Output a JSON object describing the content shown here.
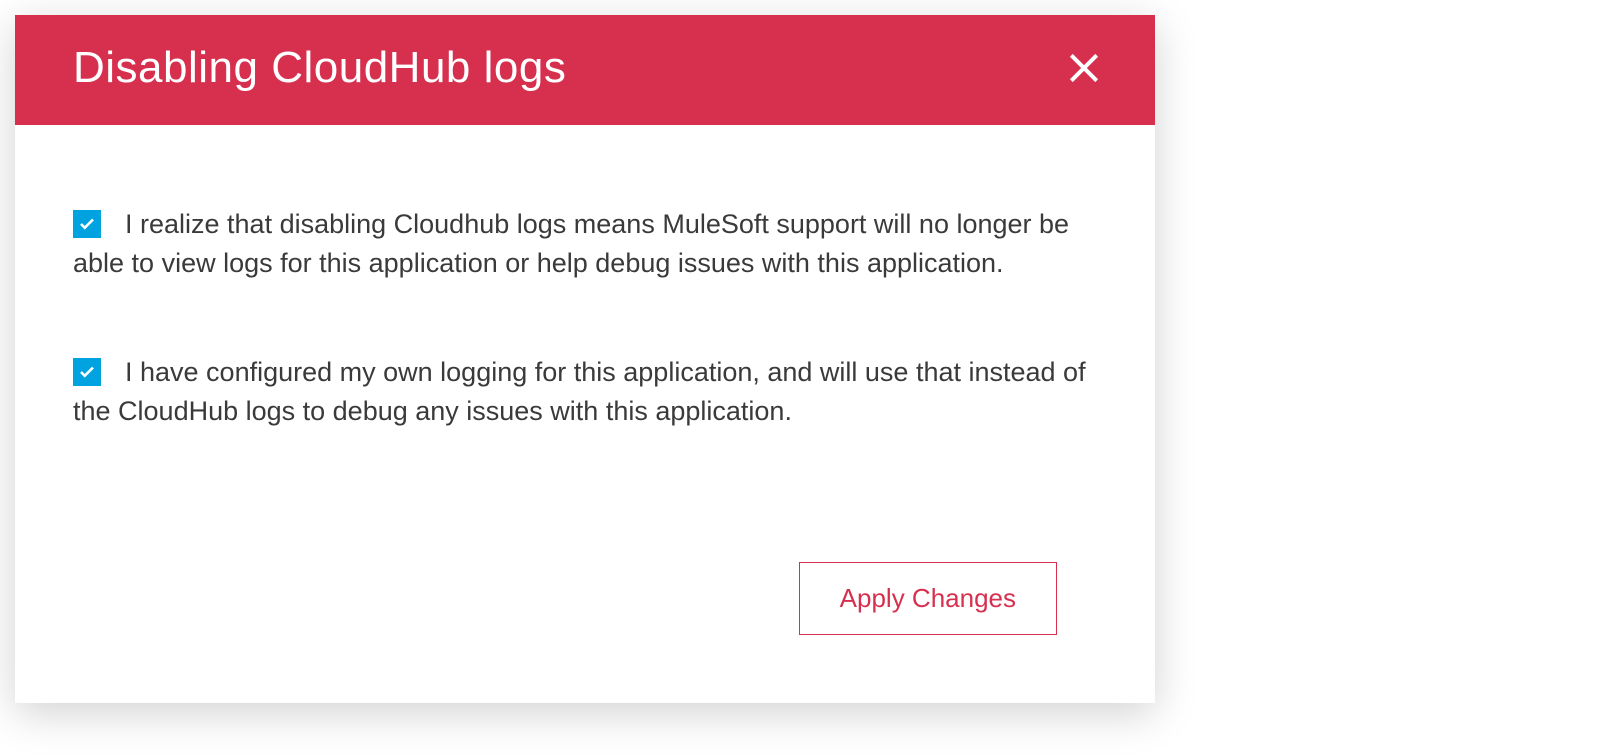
{
  "dialog": {
    "title": "Disabling CloudHub logs",
    "checkboxes": [
      {
        "checked": true,
        "label": "I realize that disabling Cloudhub logs means MuleSoft support will no longer be able to view logs for this application or help debug issues with this application."
      },
      {
        "checked": true,
        "label": "I have configured my own logging for this application, and will use that instead of the CloudHub logs to debug any issues with this application."
      }
    ],
    "apply_button_label": "Apply Changes"
  },
  "colors": {
    "header_bg": "#d7304e",
    "checkbox_bg": "#00a2df",
    "text": "#3a3a3a"
  }
}
